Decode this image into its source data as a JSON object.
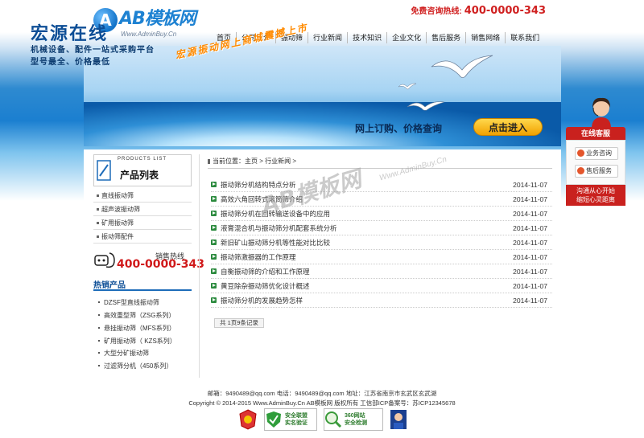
{
  "header": {
    "logo_text": "AB模板网",
    "logo_domain": "Www.AdminBuy.Cn",
    "hotline_label": "免费咨询热线:",
    "hotline_number": "400-0000-343"
  },
  "nav": [
    "首页",
    "公司简介",
    "振动筛",
    "行业新闻",
    "技术知识",
    "企业文化",
    "售后服务",
    "销售网络",
    "联系我们"
  ],
  "banner": {
    "title": "宏源在线",
    "line1": "机械设备、配件一站式采购平台",
    "line2": "型号最全、价格最低",
    "slogan": "宏源振动网上商城震撼上市",
    "order_text": "网上订购、价格查询",
    "cta": "点击进入"
  },
  "service": {
    "title": "在线客服",
    "buttons": [
      "业务咨询",
      "售后服务"
    ],
    "footer_line1": "沟通从心开始",
    "footer_line2": "缩短心灵距离"
  },
  "sidebar": {
    "products_en": "PRODUCTS LIST",
    "products_cn": "产品列表",
    "products": [
      "直线振动筛",
      "超声波振动筛",
      "矿用振动筛",
      "振动筛配件"
    ],
    "sales_label": "销售热线",
    "sales_number": "400-0000-343",
    "hot_title": "热销产品",
    "hot_items": [
      "DZSF型直线振动筛",
      "高效重型筛（ZSG系列）",
      "悬挂振动筛（MFS系列）",
      "矿用振动筛（ KZS系列）",
      "大型分矿振动筛",
      "过滤筛分机（450系列）"
    ]
  },
  "main": {
    "breadcrumb": "当前位置：主页 > 行业新闻 >",
    "articles": [
      {
        "title": "振动筛分机结构特点分析",
        "date": "2014-11-07"
      },
      {
        "title": "高效六角回转式滚筒筛介绍",
        "date": "2014-11-07"
      },
      {
        "title": "振动筛分机在回转输送设备中的应用",
        "date": "2014-11-07"
      },
      {
        "title": "液膏混合机与振动筛分机配套系统分析",
        "date": "2014-11-07"
      },
      {
        "title": "新旧矿山振动筛分机等性能对比比较",
        "date": "2014-11-07"
      },
      {
        "title": "振动筛激振器的工作原理",
        "date": "2014-11-07"
      },
      {
        "title": "自衡振动筛的介绍和工作原理",
        "date": "2014-11-07"
      },
      {
        "title": "黄豆除杂振动筛优化设计概述",
        "date": "2014-11-07"
      },
      {
        "title": "振动筛分机的发展趋势怎样",
        "date": "2014-11-07"
      }
    ],
    "pager": "共 1页9条记录"
  },
  "watermark": {
    "text": "AB模板网",
    "domain": "Www.AdminBuy.Cn"
  },
  "footer": {
    "line1": "邮箱：9490489@qq.com 电话：9490489@qq.com 地址：江苏省南京市玄武区玄武湖",
    "line2": "Copyright © 2014-2015 Www.AdminBuy.Cn AB模板网 版权所有 工信部ICP备案号：苏ICP12345678",
    "badge_safe_line1": "安全联盟",
    "badge_safe_line2": "实名验证",
    "badge_360_line1": "360网站",
    "badge_360_line2": "安全检测"
  },
  "colors": {
    "brand_blue": "#1e82d2",
    "accent_red": "#d02020",
    "cta_orange": "#f1a100"
  }
}
